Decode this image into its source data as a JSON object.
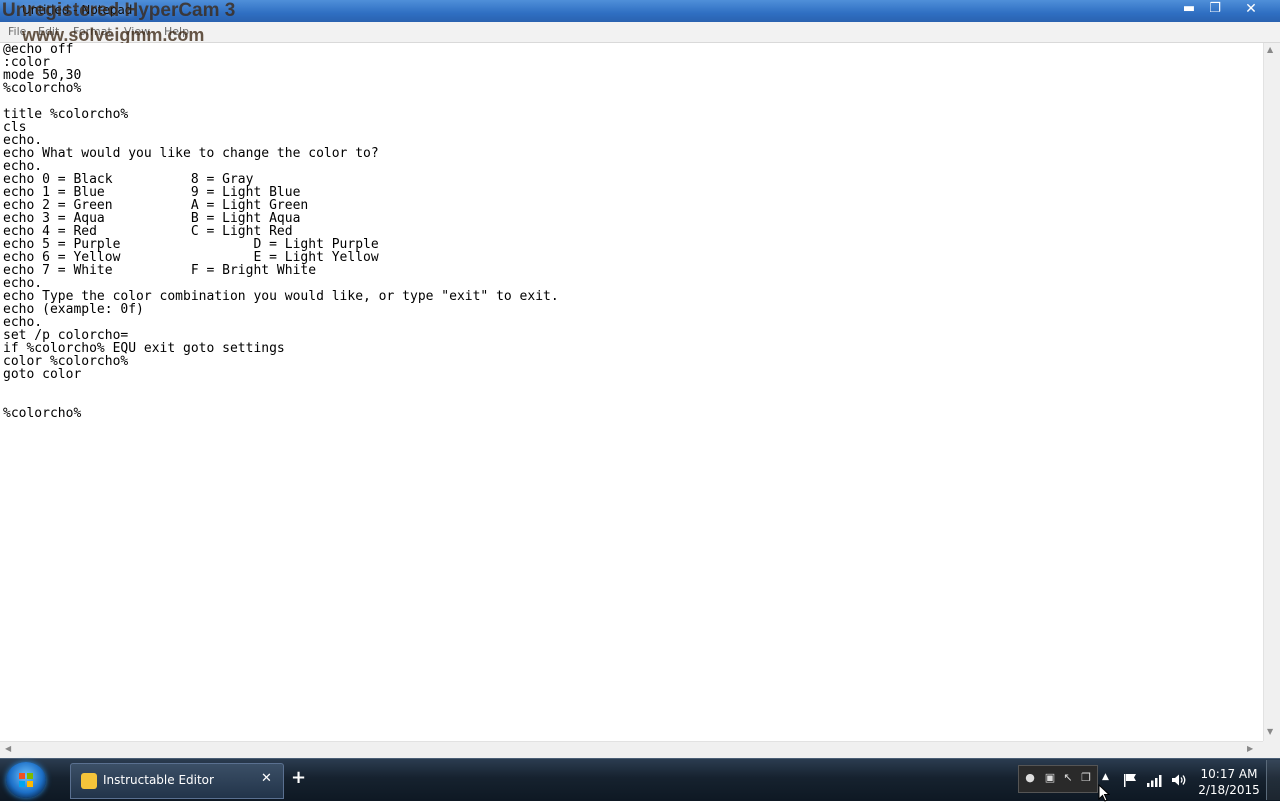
{
  "window": {
    "title": "Untitled - Notepad",
    "min_glyph": "▬",
    "max_glyph": "❐",
    "close_glyph": "✕"
  },
  "watermark": {
    "line1": "Unregistered HyperCam 3",
    "line2": "www.solveigmm.com"
  },
  "menu": [
    {
      "label": "File"
    },
    {
      "label": "Edit"
    },
    {
      "label": "Format"
    },
    {
      "label": "View"
    },
    {
      "label": "Help"
    }
  ],
  "editor": {
    "content": "@echo off\n:color\nmode 50,30\n%colorcho%\n\ntitle %colorcho%\ncls\necho.\necho What would you like to change the color to?\necho.\necho 0 = Black          8 = Gray\necho 1 = Blue           9 = Light Blue\necho 2 = Green          A = Light Green\necho 3 = Aqua           B = Light Aqua\necho 4 = Red            C = Light Red\necho 5 = Purple                 D = Light Purple\necho 6 = Yellow                 E = Light Yellow\necho 7 = White          F = Bright White\necho.\necho Type the color combination you would like, or type \"exit\" to exit.\necho (example: 0f)\necho.\nset /p colorcho=\nif %colorcho% EQU exit goto settings\ncolor %colorcho%\ngoto color\n\n\n%colorcho%"
  },
  "scrollbar": {
    "up": "▲",
    "down": "▼",
    "left": "◀",
    "right": "▶"
  },
  "taskbar": {
    "tab_label": "Instructable Editor",
    "tab_close": "✕",
    "new_tab": "+",
    "tray_expand": "▲",
    "clock_time": "10:17 AM",
    "clock_date": "2/18/2015"
  },
  "icons": {
    "start": "windows-orb-icon",
    "tab": "instructables-robot-icon",
    "flag": "action-center-flag-icon",
    "network": "network-signal-icon",
    "volume": "volume-icon"
  }
}
